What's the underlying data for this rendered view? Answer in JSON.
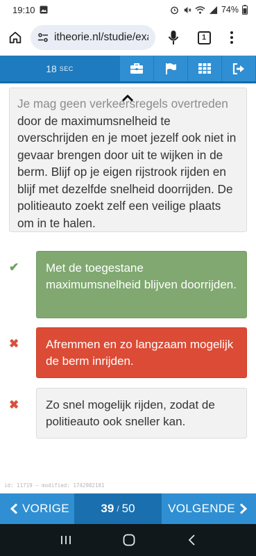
{
  "status_bar": {
    "time": "19:10",
    "battery": "74%"
  },
  "browser": {
    "url": "itheorie.nl/studie/exa",
    "tab_count": "1"
  },
  "header": {
    "timer_value": "18",
    "timer_unit": "SEC",
    "buttons": [
      "briefcase-icon",
      "flag-icon",
      "grid-icon",
      "exit-icon"
    ]
  },
  "explanation": {
    "faded_line": "Je mag geen verkeersregels overtreden",
    "text": "door de maximumsnelheid te overschrijden en je moet jezelf ook niet in gevaar brengen door uit te wijken in de berm. Blijf op je eigen rijstrook rijden en blijf met dezelfde snelheid doorrijden. De politieauto zoekt zelf een veilige plaats om in te halen."
  },
  "answers": [
    {
      "status": "correct",
      "mark": "✔",
      "text": "Met de toegestane maximumsnelheid blijven doorrijden."
    },
    {
      "status": "wrong",
      "mark": "✖",
      "text": "Afremmen en zo langzaam mogelijk de berm inrijden."
    },
    {
      "status": "neutral",
      "mark": "✖",
      "text": "Zo snel mogelijk rijden, zodat de politieauto ook sneller kan."
    }
  ],
  "meta": {
    "id_line": "id: 11719 — modified: 1742982181"
  },
  "nav": {
    "prev_label": "VORIGE",
    "next_label": "VOLGENDE",
    "current": "39",
    "separator": "/",
    "total": "50"
  },
  "colors": {
    "header_blue": "#1e7bbf",
    "button_blue": "#2f8fd2",
    "correct_green": "#80a870",
    "wrong_red": "#dc4b35"
  }
}
